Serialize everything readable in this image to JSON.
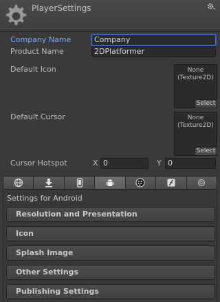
{
  "header": {
    "title": "PlayerSettings"
  },
  "fields": {
    "company_name": {
      "label": "Company Name",
      "value": "Company"
    },
    "product_name": {
      "label": "Product Name",
      "value": "2DPlatformer"
    },
    "default_icon": {
      "label": "Default Icon",
      "line1": "None",
      "line2": "(Texture2D)",
      "select": "Select"
    },
    "default_cursor": {
      "label": "Default Cursor",
      "line1": "None",
      "line2": "(Texture2D)",
      "select": "Select"
    },
    "cursor_hotspot": {
      "label": "Cursor Hotspot",
      "x_label": "X",
      "x_value": "0",
      "y_label": "Y",
      "y_value": "0"
    }
  },
  "platform_tabs": [
    {
      "icon": "web-globe-icon",
      "active": false
    },
    {
      "icon": "standalone-download-icon",
      "active": false
    },
    {
      "icon": "ios-device-icon",
      "active": false
    },
    {
      "icon": "android-icon",
      "active": true
    },
    {
      "icon": "blackberry-icon",
      "active": false
    },
    {
      "icon": "flash-icon",
      "active": false
    },
    {
      "icon": "other-platform-icon",
      "active": false
    }
  ],
  "platform": {
    "title": "Settings for Android",
    "sections": [
      "Resolution and Presentation",
      "Icon",
      "Splash Image",
      "Other Settings",
      "Publishing Settings"
    ]
  }
}
